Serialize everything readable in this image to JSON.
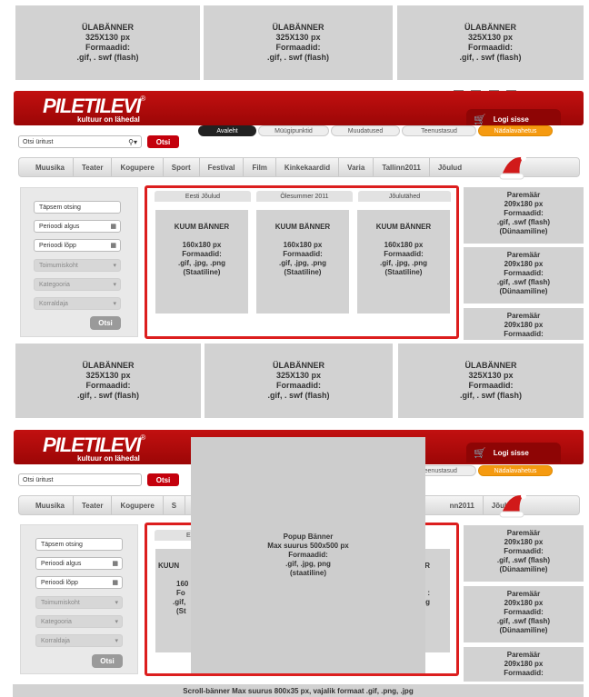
{
  "top_banners": [
    {
      "l1": "ÜLABÄNNER",
      "l2": "325X130 px",
      "l3": "Formaadid:",
      "l4": ".gif, . swf (flash)"
    },
    {
      "l1": "ÜLABÄNNER",
      "l2": "325X130 px",
      "l3": "Formaadid:",
      "l4": ".gif, . swf (flash)"
    },
    {
      "l1": "ÜLABÄNNER",
      "l2": "325X130 px",
      "l3": "Formaadid:",
      "l4": ".gif, . swf (flash)"
    }
  ],
  "header": {
    "logo": "PILETILEVI",
    "logo_reg": "®",
    "tagline": "kultuur on lähedal",
    "login": "Logi sisse",
    "tabs": [
      "Avaleht",
      "Müügipunktid",
      "Muudatused",
      "Teenustasud",
      "Nädalavahetus"
    ],
    "search_placeholder": "Otsi üritust",
    "search_button": "Otsi",
    "flags": [
      "ee",
      "ru",
      "gb",
      "fi"
    ]
  },
  "nav": [
    "Muusika",
    "Teater",
    "Kogupere",
    "Sport",
    "Festival",
    "Film",
    "Kinkekaardid",
    "Varia",
    "Tallinn2011",
    "Jõulud"
  ],
  "form": {
    "exact": "Täpsem otsing",
    "start": "Perioodi algus",
    "end": "Perioodi lõpp",
    "venue": "Toimumiskoht",
    "category": "Kategooria",
    "organizer": "Korraldaja",
    "submit": "Otsi"
  },
  "hot": {
    "tabs": [
      "Eesti Jõulud",
      "Ölesummer 2011",
      "Jõulutähed"
    ],
    "card": {
      "l1": "KUUM BÄNNER",
      "l2": "160x180 px",
      "l3": "Formaadid:",
      "l4": ".gif, .jpg, .png",
      "l5": "(Staatiline)"
    }
  },
  "right_banners": [
    {
      "l1": "Paremäär",
      "l2": "209x180 px",
      "l3": "Formaadid:",
      "l4": ".gif, .swf (flash)",
      "l5": "(Dünaamiline)"
    },
    {
      "l1": "Paremäär",
      "l2": "209x180 px",
      "l3": "Formaadid:",
      "l4": ".gif, .swf (flash)",
      "l5": "(Dünaamiline)"
    },
    {
      "l1": "Paremäär",
      "l2": "209x180 px",
      "l3": "Formaadid:"
    }
  ],
  "middle_banners": [
    {
      "l1": "ÜLABÄNNER",
      "l2": "325X130 px",
      "l3": "Formaadid:",
      "l4": ".gif, . swf (flash)"
    },
    {
      "l1": "ÜLABÄNNER",
      "l2": "325X130 px",
      "l3": "Formaadid:",
      "l4": ".gif, . swf (flash)"
    },
    {
      "l1": "ÜLABÄNNER",
      "l2": "325X130 px",
      "l3": "Formaadid:",
      "l4": ".gif, . swf (flash)"
    }
  ],
  "popup": {
    "l1": "Popup Bänner",
    "l2": "Max suurus 500x500 px",
    "l3": "Formaadid:",
    "l4": ".gif, .jpg, png",
    "l5": "(staatiline)"
  },
  "copy2": {
    "partial_tab": "Teenustasud",
    "partial_nav": "nn2011",
    "nav_left": [
      "Muusika",
      "Teater",
      "Kogupere",
      "S"
    ],
    "hot_partial_left": "Ee",
    "card_partial_left": [
      "KUUN",
      "160",
      "Fo",
      ".gif,",
      "(St"
    ],
    "card_partial_right": [
      "R",
      ":",
      "g"
    ]
  },
  "scroll_banner": "Scroll-bänner Max suurus 800x35 px, vajalik formaat .gif, .png, .jpg"
}
